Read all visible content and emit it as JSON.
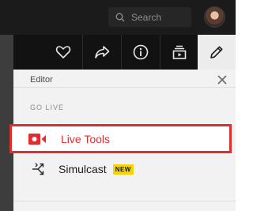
{
  "header": {
    "search_placeholder": "Search"
  },
  "toolbar": {
    "icons": [
      "heart-icon",
      "share-icon",
      "info-icon",
      "collection-icon",
      "pencil-icon"
    ],
    "active_icon": "pencil-icon"
  },
  "panel": {
    "title": "Editor",
    "section_label": "GO LIVE",
    "items": [
      {
        "label": "Live Tools",
        "icon": "live-camera-icon",
        "highlighted": true
      },
      {
        "label": "Simulcast",
        "icon": "simulcast-icon",
        "badge": "NEW"
      }
    ]
  },
  "colors": {
    "accent_red": "#e02e2e",
    "badge_yellow": "#f5d400",
    "topbar": "#1b1b1b"
  }
}
